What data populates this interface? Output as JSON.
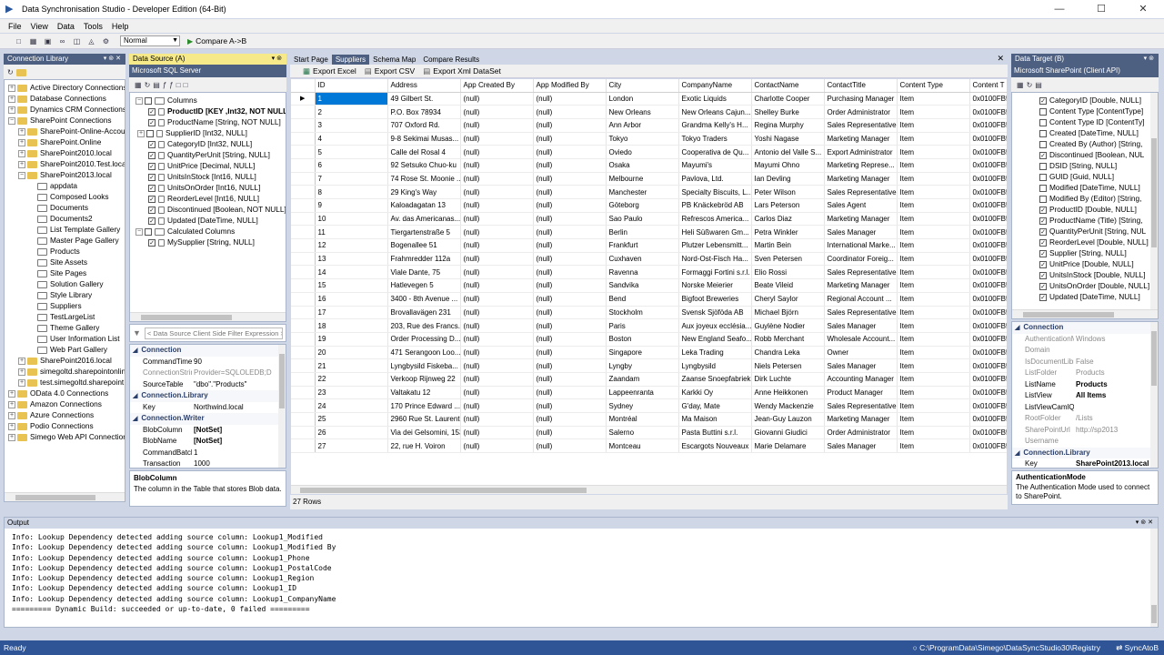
{
  "window": {
    "title": "Data Synchronisation Studio - Developer Edition (64-Bit)"
  },
  "menu": [
    "File",
    "View",
    "Data",
    "Tools",
    "Help"
  ],
  "toolbar": {
    "mode": "Normal",
    "compare_label": "Compare A->B"
  },
  "connection_library": {
    "title": "Connection Library",
    "items": [
      {
        "label": "Active Directory Connections",
        "level": 0,
        "expander": "+",
        "icon": "y"
      },
      {
        "label": "Database Connections",
        "level": 0,
        "expander": "+",
        "icon": "y"
      },
      {
        "label": "Dynamics CRM Connections",
        "level": 0,
        "expander": "+",
        "icon": "y"
      },
      {
        "label": "SharePoint Connections",
        "level": 0,
        "expander": "-",
        "icon": "y"
      },
      {
        "label": "SharePoint-Online-Account",
        "level": 1,
        "expander": "+",
        "icon": "y"
      },
      {
        "label": "SharePoint.Online",
        "level": 1,
        "expander": "+",
        "icon": "y"
      },
      {
        "label": "SharePoint2010.local",
        "level": 1,
        "expander": "+",
        "icon": "y"
      },
      {
        "label": "SharePoint2010.Test.local",
        "level": 1,
        "expander": "+",
        "icon": "y"
      },
      {
        "label": "SharePoint2013.local",
        "level": 1,
        "expander": "-",
        "icon": "y"
      },
      {
        "label": "appdata",
        "level": 2,
        "expander": "",
        "icon": "t"
      },
      {
        "label": "Composed Looks",
        "level": 2,
        "expander": "",
        "icon": "t"
      },
      {
        "label": "Documents",
        "level": 2,
        "expander": "",
        "icon": "t"
      },
      {
        "label": "Documents2",
        "level": 2,
        "expander": "",
        "icon": "t"
      },
      {
        "label": "List Template Gallery",
        "level": 2,
        "expander": "",
        "icon": "t"
      },
      {
        "label": "Master Page Gallery",
        "level": 2,
        "expander": "",
        "icon": "t"
      },
      {
        "label": "Products",
        "level": 2,
        "expander": "",
        "icon": "t"
      },
      {
        "label": "Site Assets",
        "level": 2,
        "expander": "",
        "icon": "t"
      },
      {
        "label": "Site Pages",
        "level": 2,
        "expander": "",
        "icon": "t"
      },
      {
        "label": "Solution Gallery",
        "level": 2,
        "expander": "",
        "icon": "t"
      },
      {
        "label": "Style Library",
        "level": 2,
        "expander": "",
        "icon": "t"
      },
      {
        "label": "Suppliers",
        "level": 2,
        "expander": "",
        "icon": "t"
      },
      {
        "label": "TestLargeList",
        "level": 2,
        "expander": "",
        "icon": "t"
      },
      {
        "label": "Theme Gallery",
        "level": 2,
        "expander": "",
        "icon": "t"
      },
      {
        "label": "User Information List",
        "level": 2,
        "expander": "",
        "icon": "t"
      },
      {
        "label": "Web Part Gallery",
        "level": 2,
        "expander": "",
        "icon": "t"
      },
      {
        "label": "SharePoint2016.local",
        "level": 1,
        "expander": "+",
        "icon": "y"
      },
      {
        "label": "simegoltd.sharepointonline",
        "level": 1,
        "expander": "+",
        "icon": "y"
      },
      {
        "label": "test.simegoltd.sharepoint",
        "level": 1,
        "expander": "+",
        "icon": "y"
      },
      {
        "label": "OData 4.0 Connections",
        "level": 0,
        "expander": "+",
        "icon": "y"
      },
      {
        "label": "Amazon Connections",
        "level": 0,
        "expander": "+",
        "icon": "y"
      },
      {
        "label": "Azure Connections",
        "level": 0,
        "expander": "+",
        "icon": "y"
      },
      {
        "label": "Podio Connections",
        "level": 0,
        "expander": "+",
        "icon": "y"
      },
      {
        "label": "Simego Web API Connections",
        "level": 0,
        "expander": "+",
        "icon": "y"
      }
    ]
  },
  "source": {
    "title": "Data Source (A)",
    "provider": "Microsoft SQL Server",
    "tree": [
      {
        "label": "Columns",
        "level": 0,
        "kind": "group"
      },
      {
        "label": "ProductID [KEY ,Int32, NOT NULL]",
        "level": 1,
        "checked": true,
        "bold": true
      },
      {
        "label": "ProductName [String, NOT NULL]",
        "level": 1,
        "checked": true
      },
      {
        "label": "SupplierID [Int32, NULL]",
        "level": 1,
        "checked": false,
        "expander": "+"
      },
      {
        "label": "CategoryID [Int32, NULL]",
        "level": 1,
        "checked": true
      },
      {
        "label": "QuantityPerUnit [String, NULL]",
        "level": 1,
        "checked": true
      },
      {
        "label": "UnitPrice [Decimal, NULL]",
        "level": 1,
        "checked": true
      },
      {
        "label": "UnitsInStock [Int16, NULL]",
        "level": 1,
        "checked": true
      },
      {
        "label": "UnitsOnOrder [Int16, NULL]",
        "level": 1,
        "checked": true
      },
      {
        "label": "ReorderLevel [Int16, NULL]",
        "level": 1,
        "checked": true
      },
      {
        "label": "Discontinued [Boolean, NOT NULL]",
        "level": 1,
        "checked": true
      },
      {
        "label": "Updated [DateTime, NULL]",
        "level": 1,
        "checked": true
      },
      {
        "label": "Calculated Columns",
        "level": 0,
        "kind": "group"
      },
      {
        "label": "MySupplier [String, NULL]",
        "level": 1,
        "checked": true
      }
    ],
    "filter_placeholder": "< Data Source Client Side Filter Expression >",
    "props": [
      {
        "cat": "Connection"
      },
      {
        "k": "CommandTimeout",
        "v": "90"
      },
      {
        "k": "ConnectionString",
        "v": "Provider=SQLOLEDB;D",
        "dis": true
      },
      {
        "k": "SourceTable",
        "v": "\"dbo\".\"Products\""
      },
      {
        "cat": "Connection.Library"
      },
      {
        "k": "Key",
        "v": "Northwind.local"
      },
      {
        "cat": "Connection.Writer"
      },
      {
        "k": "BlobColumn",
        "v": "[NotSet]",
        "bold": true
      },
      {
        "k": "BlobName",
        "v": "[NotSet]",
        "bold": true
      },
      {
        "k": "CommandBatchSize",
        "v": "1"
      },
      {
        "k": "Transaction",
        "v": "1000"
      }
    ],
    "help_title": "BlobColumn",
    "help_text": "The column in the Table that stores Blob data."
  },
  "center": {
    "tabs": [
      "Start Page",
      "Suppliers",
      "Schema Map",
      "Compare Results"
    ],
    "selected_tab": 1,
    "actions": [
      "Export Excel",
      "Export CSV",
      "Export Xml DataSet"
    ],
    "columns": [
      "ID",
      "Address",
      "App Created By",
      "App Modified By",
      "City",
      "CompanyName",
      "ContactName",
      "ContactTitle",
      "Content Type",
      "Content T"
    ],
    "rows": [
      [
        "1",
        "49 Gilbert St.",
        "(null)",
        "(null)",
        "London",
        "Exotic Liquids",
        "Charlotte Cooper",
        "Purchasing Manager",
        "Item",
        "0x0100FB5"
      ],
      [
        "2",
        "P.O. Box 78934",
        "(null)",
        "(null)",
        "New Orleans",
        "New Orleans Cajun...",
        "Shelley Burke",
        "Order Administrator",
        "Item",
        "0x0100FB5"
      ],
      [
        "3",
        "707 Oxford Rd.",
        "(null)",
        "(null)",
        "Ann Arbor",
        "Grandma Kelly's H...",
        "Regina Murphy",
        "Sales Representative",
        "Item",
        "0x0100FB5"
      ],
      [
        "4",
        "9-8 Sekimai Musas...",
        "(null)",
        "(null)",
        "Tokyo",
        "Tokyo Traders",
        "Yoshi Nagase",
        "Marketing Manager",
        "Item",
        "0x0100FB5"
      ],
      [
        "5",
        "Calle del Rosal 4",
        "(null)",
        "(null)",
        "Oviedo",
        "Cooperativa de Qu...",
        "Antonio del Valle S...",
        "Export Administrator",
        "Item",
        "0x0100FB5"
      ],
      [
        "6",
        "92 Setsuko Chuo-ku",
        "(null)",
        "(null)",
        "Osaka",
        "Mayumi's",
        "Mayumi Ohno",
        "Marketing Represe...",
        "Item",
        "0x0100FB5"
      ],
      [
        "7",
        "74 Rose St. Moonie ...",
        "(null)",
        "(null)",
        "Melbourne",
        "Pavlova, Ltd.",
        "Ian Devling",
        "Marketing Manager",
        "Item",
        "0x0100FB5"
      ],
      [
        "8",
        "29 King's Way",
        "(null)",
        "(null)",
        "Manchester",
        "Specialty Biscuits, L...",
        "Peter Wilson",
        "Sales Representative",
        "Item",
        "0x0100FB5"
      ],
      [
        "9",
        "Kaloadagatan 13",
        "(null)",
        "(null)",
        "Göteborg",
        "PB Knäckebröd AB",
        "Lars Peterson",
        "Sales Agent",
        "Item",
        "0x0100FB5"
      ],
      [
        "10",
        "Av. das Americanas...",
        "(null)",
        "(null)",
        "Sao Paulo",
        "Refrescos America...",
        "Carlos Diaz",
        "Marketing Manager",
        "Item",
        "0x0100FB5"
      ],
      [
        "11",
        "Tiergartenstraße 5",
        "(null)",
        "(null)",
        "Berlin",
        "Heli Süßwaren Gm...",
        "Petra Winkler",
        "Sales Manager",
        "Item",
        "0x0100FB5"
      ],
      [
        "12",
        "Bogenallee 51",
        "(null)",
        "(null)",
        "Frankfurt",
        "Plutzer Lebensmitt...",
        "Martin Bein",
        "International Marke...",
        "Item",
        "0x0100FB5"
      ],
      [
        "13",
        "Frahmredder 112a",
        "(null)",
        "(null)",
        "Cuxhaven",
        "Nord-Ost-Fisch Ha...",
        "Sven Petersen",
        "Coordinator Foreig...",
        "Item",
        "0x0100FB5"
      ],
      [
        "14",
        "Viale Dante, 75",
        "(null)",
        "(null)",
        "Ravenna",
        "Formaggi Fortini s.r.l.",
        "Elio Rossi",
        "Sales Representative",
        "Item",
        "0x0100FB5"
      ],
      [
        "15",
        "Hatlevegen 5",
        "(null)",
        "(null)",
        "Sandvika",
        "Norske Meierier",
        "Beate Vileid",
        "Marketing Manager",
        "Item",
        "0x0100FB5"
      ],
      [
        "16",
        "3400 - 8th Avenue ...",
        "(null)",
        "(null)",
        "Bend",
        "Bigfoot Breweries",
        "Cheryl Saylor",
        "Regional Account ...",
        "Item",
        "0x0100FB5"
      ],
      [
        "17",
        "Brovallavägen 231",
        "(null)",
        "(null)",
        "Stockholm",
        "Svensk Sjöföda AB",
        "Michael Björn",
        "Sales Representative",
        "Item",
        "0x0100FB5"
      ],
      [
        "18",
        "203, Rue des Francs...",
        "(null)",
        "(null)",
        "Paris",
        "Aux joyeux ecclésia...",
        "Guylène Nodier",
        "Sales Manager",
        "Item",
        "0x0100FB5"
      ],
      [
        "19",
        "Order Processing D...",
        "(null)",
        "(null)",
        "Boston",
        "New England Seafo...",
        "Robb Merchant",
        "Wholesale Account...",
        "Item",
        "0x0100FB5"
      ],
      [
        "20",
        "471 Serangoon Loo...",
        "(null)",
        "(null)",
        "Singapore",
        "Leka Trading",
        "Chandra Leka",
        "Owner",
        "Item",
        "0x0100FB5"
      ],
      [
        "21",
        "Lyngbysild Fiskeba...",
        "(null)",
        "(null)",
        "Lyngby",
        "Lyngbysild",
        "Niels Petersen",
        "Sales Manager",
        "Item",
        "0x0100FB5"
      ],
      [
        "22",
        "Verkoop Rijnweg 22",
        "(null)",
        "(null)",
        "Zaandam",
        "Zaanse Snoepfabriek",
        "Dirk Luchte",
        "Accounting Manager",
        "Item",
        "0x0100FB5"
      ],
      [
        "23",
        "Valtakatu 12",
        "(null)",
        "(null)",
        "Lappeenranta",
        "Karkki Oy",
        "Anne Heikkonen",
        "Product Manager",
        "Item",
        "0x0100FB5"
      ],
      [
        "24",
        "170 Prince Edward ...",
        "(null)",
        "(null)",
        "Sydney",
        "G'day, Mate",
        "Wendy Mackenzie",
        "Sales Representative",
        "Item",
        "0x0100FB5"
      ],
      [
        "25",
        "2960 Rue St. Laurent",
        "(null)",
        "(null)",
        "Montréal",
        "Ma Maison",
        "Jean-Guy Lauzon",
        "Marketing Manager",
        "Item",
        "0x0100FB5"
      ],
      [
        "26",
        "Via dei Gelsomini, 153",
        "(null)",
        "(null)",
        "Salerno",
        "Pasta Buttini s.r.l.",
        "Giovanni Giudici",
        "Order Administrator",
        "Item",
        "0x0100FB5"
      ],
      [
        "27",
        "22, rue H. Voiron",
        "(null)",
        "(null)",
        "Montceau",
        "Escargots Nouveaux",
        "Marie Delamare",
        "Sales Manager",
        "Item",
        "0x0100FB5"
      ]
    ],
    "row_count": "27 Rows"
  },
  "target": {
    "title": "Data Target (B)",
    "provider": "Microsoft SharePoint (Client API)",
    "columns": [
      {
        "label": "CategoryID [Double, NULL]",
        "checked": true
      },
      {
        "label": "Content Type [ContentType]",
        "checked": false
      },
      {
        "label": "Content Type ID [ContentTy]",
        "checked": false
      },
      {
        "label": "Created [DateTime, NULL]",
        "checked": false
      },
      {
        "label": "Created By (Author) [String,",
        "checked": false
      },
      {
        "label": "Discontinued [Boolean, NUL",
        "checked": true
      },
      {
        "label": "DSID [String, NULL]",
        "checked": false
      },
      {
        "label": "GUID [Guid, NULL]",
        "checked": false
      },
      {
        "label": "Modified [DateTime, NULL]",
        "checked": false
      },
      {
        "label": "Modified By (Editor) [String,",
        "checked": false
      },
      {
        "label": "ProductID [Double, NULL]",
        "checked": true
      },
      {
        "label": "ProductName (Title) [String,",
        "checked": true
      },
      {
        "label": "QuantityPerUnit [String, NUL",
        "checked": true
      },
      {
        "label": "ReorderLevel [Double, NULL]",
        "checked": true
      },
      {
        "label": "Supplier [String, NULL]",
        "checked": true
      },
      {
        "label": "UnitPrice [Double, NULL]",
        "checked": true
      },
      {
        "label": "UnitsInStock [Double, NULL]",
        "checked": true
      },
      {
        "label": "UnitsOnOrder [Double, NULL]",
        "checked": true
      },
      {
        "label": "Updated [DateTime, NULL]",
        "checked": true
      }
    ],
    "props": [
      {
        "cat": "Connection"
      },
      {
        "k": "AuthenticationMode",
        "v": "Windows",
        "dis": true
      },
      {
        "k": "Domain",
        "v": "",
        "dis": true
      },
      {
        "k": "IsDocumentLibrary",
        "v": "False",
        "dis": true
      },
      {
        "k": "ListFolder",
        "v": "Products",
        "dis": true
      },
      {
        "k": "ListName",
        "v": "Products",
        "bold": true
      },
      {
        "k": "ListView",
        "v": "All Items",
        "bold": true
      },
      {
        "k": "ListViewCamlQuery",
        "v": ""
      },
      {
        "k": "RootFolder",
        "v": "/Lists",
        "dis": true
      },
      {
        "k": "SharePointUrl",
        "v": "http://sp2013",
        "dis": true
      },
      {
        "k": "Username",
        "v": "",
        "dis": true
      },
      {
        "cat": "Connection.Library"
      },
      {
        "k": "Key",
        "v": "SharePoint2013.local",
        "bold": true
      }
    ],
    "help_title": "AuthenticationMode",
    "help_text": "The Authentication Mode used to connect to SharePoint."
  },
  "output": {
    "title": "Output",
    "lines": [
      "Info: Lookup Dependency detected adding source column: Lookup1_Modified",
      "Info: Lookup Dependency detected adding source column: Lookup1_Modified By",
      "Info: Lookup Dependency detected adding source column: Lookup1_Phone",
      "Info: Lookup Dependency detected adding source column: Lookup1_PostalCode",
      "Info: Lookup Dependency detected adding source column: Lookup1_Region",
      "Info: Lookup Dependency detected adding source column: Lookup1_ID",
      "Info: Lookup Dependency detected adding source column: Lookup1_CompanyName",
      "========= Dynamic Build: succeeded or up-to-date, 0 failed ========="
    ]
  },
  "status": {
    "left": "Ready",
    "path": "C:\\ProgramData\\Simego\\DataSyncStudio30\\Registry",
    "mode": "SyncAtoB"
  }
}
